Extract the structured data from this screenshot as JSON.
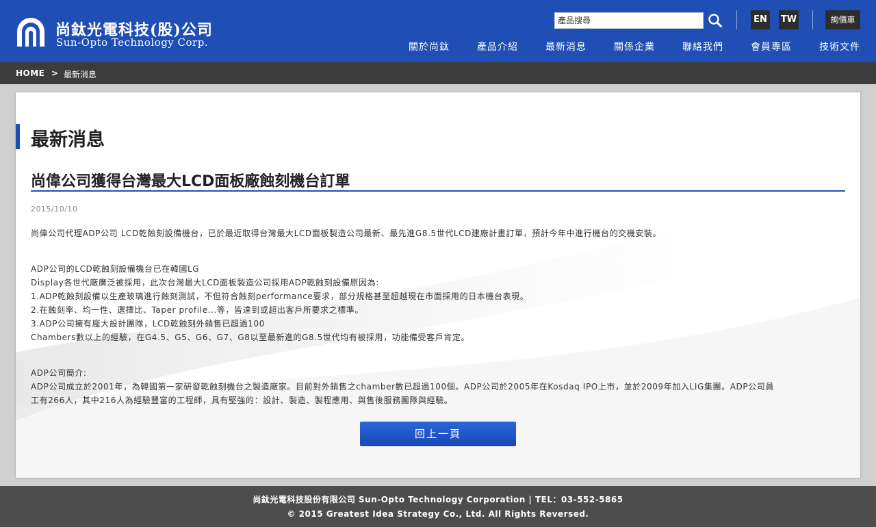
{
  "header": {
    "logo_zh": "尚鈦光電科技(股)公司",
    "logo_en": "Sun-Opto Technology Corp.",
    "search_placeholder": "產品搜尋",
    "lang_en": "EN",
    "lang_tw": "TW",
    "inquiry": "詢價車",
    "nav": [
      "關於尚鈦",
      "產品介紹",
      "最新消息",
      "關係企業",
      "聯絡我們",
      "會員專區",
      "技術文件"
    ]
  },
  "breadcrumb": {
    "home": "HOME",
    "sep": ">",
    "current": "最新消息"
  },
  "content": {
    "section_title": "最新消息",
    "article_title": "尚偉公司獲得台灣最大LCD面板廠蝕刻機台訂單",
    "date": "2015/10/10",
    "p1": "尚偉公司代理ADP公司 LCD乾蝕刻設備機台，已於最近取得台灣最大LCD面板製造公司最新、最先進G8.5世代LCD建廠計畫訂單，預計今年中進行機台的交機安裝。",
    "p2": [
      "ADP公司的LCD乾蝕刻設備機台已在韓國LG",
      "Display各世代廠廣泛被採用，此次台灣最大LCD面板製造公司採用ADP乾蝕刻設備原因為:",
      "1.ADP乾蝕刻設備以生產玻璃進行蝕刻測試，不但符合蝕刻performance要求，部分規格甚至超越現在市面採用的日本機台表現。",
      "2.在蝕刻率、均一性、選擇比、Taper profile...等，皆達到或超出客戶所要求之標準。",
      "3.ADP公司擁有龐大設計團隊，LCD乾蝕刻外銷售已超過100",
      "Chambers數以上的經驗，在G4.5、G5、G6、G7、G8以至最新進的G8.5世代均有被採用，功能備受客戶肯定。"
    ],
    "p3": [
      "ADP公司簡介:",
      "ADP公司成立於2001年，為韓國第一家研發乾蝕刻機台之製造廠家。目前對外銷售之chamber數已超過100個。ADP公司於2005年在Kosdaq IPO上市，並於2009年加入LIG集團。ADP公司員",
      "工有266人，其中216人為經驗豐富的工程師，具有堅強的：設計、製造、製程應用、與售後服務團隊與經驗。"
    ],
    "back_button": "回上一頁"
  },
  "footer": {
    "line1": "尚鈦光電科技股份有限公司 Sun-Opto Technology Corporation | TEL：03-552-5865",
    "line2": "© 2015 Greatest Idea Strategy Co., Ltd. All Rights Reversed."
  }
}
